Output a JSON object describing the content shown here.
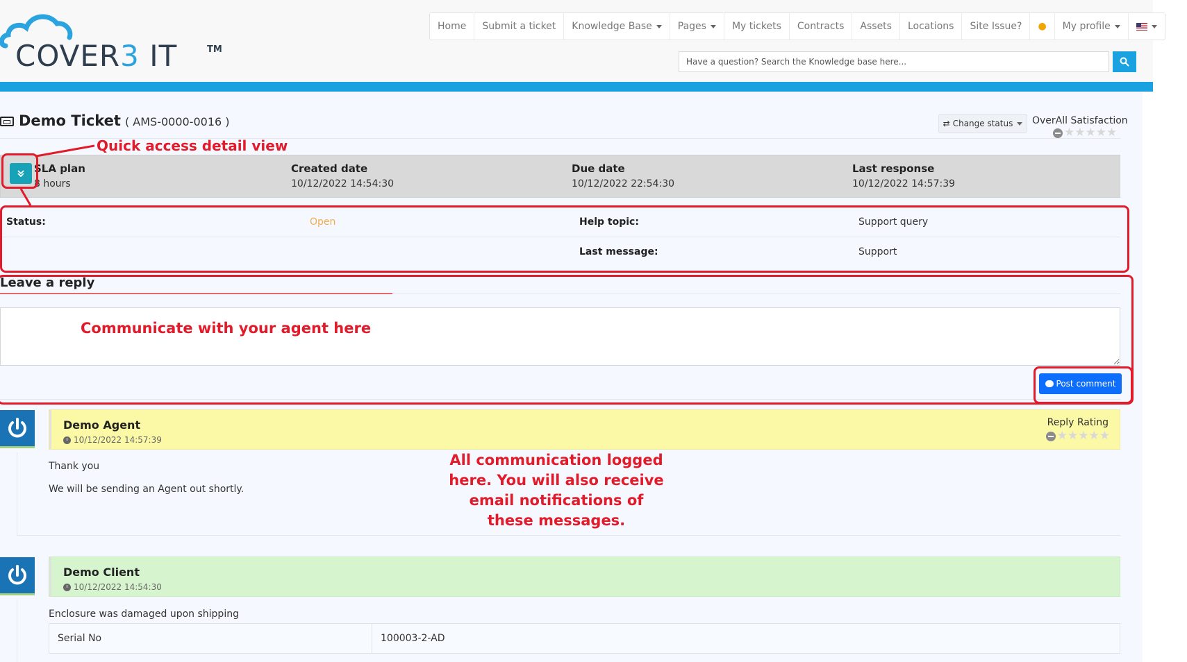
{
  "brand": {
    "logo_text_a": "COVER",
    "logo_text_b": "3",
    "logo_text_c": " IT",
    "trademark": "TM",
    "accent_color": "#1aa1e0"
  },
  "nav": {
    "items": [
      {
        "label": "Home",
        "dropdown": false
      },
      {
        "label": "Submit a ticket",
        "dropdown": false
      },
      {
        "label": "Knowledge Base",
        "dropdown": true
      },
      {
        "label": "Pages",
        "dropdown": true
      },
      {
        "label": "My tickets",
        "dropdown": false
      },
      {
        "label": "Contracts",
        "dropdown": false
      },
      {
        "label": "Assets",
        "dropdown": false
      },
      {
        "label": "Locations",
        "dropdown": false
      },
      {
        "label": "Site Issue?",
        "dropdown": false
      }
    ],
    "idea_icon": "lightbulb-icon",
    "profile_label": "My profile",
    "language_icon": "us-flag-icon"
  },
  "search": {
    "placeholder": "Have a question? Search the Knowledge base here...",
    "icon": "search-icon"
  },
  "ticket": {
    "title": "Demo Ticket",
    "code": "( AMS-0000-0016 )",
    "change_status_label": "Change status",
    "overall_label": "OverAll Satisfaction",
    "overall_rating": 0,
    "sla": [
      {
        "label": "SLA plan",
        "value": "8 hours"
      },
      {
        "label": "Created date",
        "value": "10/12/2022 14:54:30"
      },
      {
        "label": "Due date",
        "value": "10/12/2022 22:54:30"
      },
      {
        "label": "Last response",
        "value": "10/12/2022 14:57:39"
      }
    ],
    "details": {
      "status_label": "Status:",
      "status_value": "Open",
      "status_color": "#f0ad4e",
      "help_topic_label": "Help topic:",
      "help_topic_value": "Support query",
      "last_message_label": "Last message:",
      "last_message_value": "Support"
    }
  },
  "reply": {
    "title": "Leave a reply",
    "textarea_value": "",
    "post_label": "Post comment"
  },
  "messages": [
    {
      "author": "Demo Agent",
      "date": "10/12/2022 14:57:39",
      "kind": "agent",
      "rating_label": "Reply Rating",
      "rating": 0,
      "lines": [
        "Thank you",
        "We will be sending an Agent out shortly."
      ]
    },
    {
      "author": "Demo Client",
      "date": "10/12/2022 14:54:30",
      "kind": "client",
      "lines": [
        "Enclosure was damaged upon shipping"
      ],
      "fields": [
        {
          "key": "Serial No",
          "value": "100003-2-AD"
        }
      ]
    }
  ],
  "annotations": {
    "quick_access": "Quick access detail view",
    "communicate": "Communicate with your agent here",
    "logged": [
      "All communication logged",
      "here. You will also receive",
      "email notifications of",
      "these messages."
    ],
    "color": "#e21b2b"
  }
}
